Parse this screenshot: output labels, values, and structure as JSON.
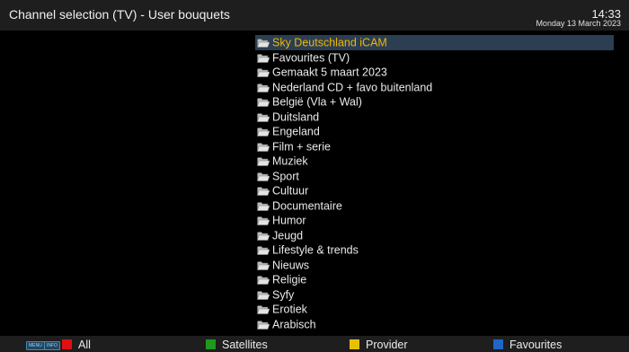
{
  "header": {
    "title": "Channel selection (TV) - User bouquets",
    "time": "14:33",
    "date": "Monday 13 March 2023"
  },
  "bouquets": [
    {
      "label": "Sky Deutschland iCAM",
      "selected": true
    },
    {
      "label": "Favourites (TV)"
    },
    {
      "label": "Gemaakt 5 maart 2023"
    },
    {
      "label": "Nederland CD + favo buitenland"
    },
    {
      "label": "België (Vla + Wal)"
    },
    {
      "label": "Duitsland"
    },
    {
      "label": "Engeland"
    },
    {
      "label": "Film + serie"
    },
    {
      "label": "Muziek"
    },
    {
      "label": "Sport"
    },
    {
      "label": "Cultuur"
    },
    {
      "label": "Documentaire"
    },
    {
      "label": "Humor"
    },
    {
      "label": "Jeugd"
    },
    {
      "label": "Lifestyle & trends"
    },
    {
      "label": "Nieuws"
    },
    {
      "label": "Religie"
    },
    {
      "label": "Syfy"
    },
    {
      "label": "Erotiek"
    },
    {
      "label": "Arabisch"
    }
  ],
  "footer": {
    "menu_key": "MENU",
    "info_key": "INFO",
    "buttons": [
      {
        "label": "All",
        "color": "#e01010",
        "icon": "red-key"
      },
      {
        "label": "Satellites",
        "color": "#1f9a1f",
        "icon": "green-key"
      },
      {
        "label": "Provider",
        "color": "#e8c000",
        "icon": "yellow-key"
      },
      {
        "label": "Favourites",
        "color": "#1f66c8",
        "icon": "blue-key"
      }
    ]
  },
  "colors": {
    "selected_text": "#f0b800",
    "selected_bg": "#2c3e52",
    "bar_bg": "#1e1e1e"
  }
}
